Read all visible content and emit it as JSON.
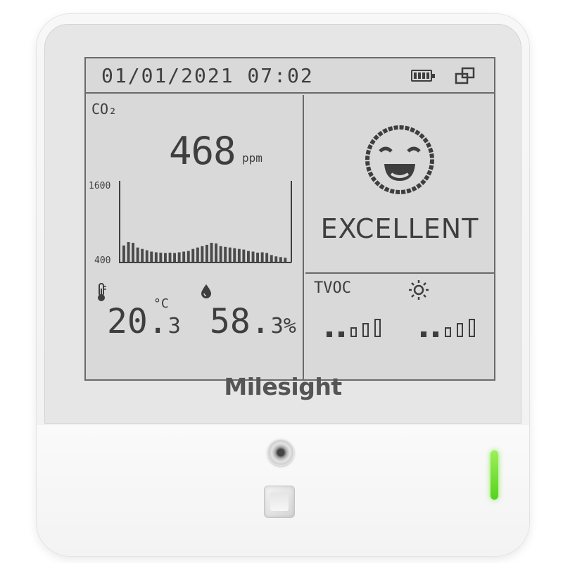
{
  "header": {
    "datetime": "01/01/2021  07:02",
    "battery_icon": "battery-icon",
    "network_icon": "network-icon"
  },
  "co2": {
    "label": "CO₂",
    "value": "468",
    "unit": "ppm"
  },
  "chart_data": {
    "type": "bar",
    "y_tick_labels": [
      "1600",
      "400"
    ],
    "ylim": [
      400,
      1600
    ],
    "values": [
      650,
      700,
      690,
      620,
      600,
      580,
      560,
      550,
      545,
      540,
      545,
      540,
      550,
      560,
      570,
      600,
      620,
      640,
      660,
      690,
      680,
      640,
      630,
      620,
      610,
      600,
      590,
      570,
      560,
      545,
      550,
      540,
      510,
      490,
      480,
      470
    ],
    "grid": false
  },
  "temperature": {
    "value_int": "20.",
    "value_dec": "3",
    "unit": "°C",
    "icon": "thermometer-icon"
  },
  "humidity": {
    "value_int": "58.",
    "value_dec": "3%",
    "icon": "water-drop-icon"
  },
  "status": {
    "icon": "smiley-face-icon",
    "text": "EXCELLENT"
  },
  "tvoc": {
    "label": "TVOC",
    "level": 2,
    "max": 5
  },
  "light": {
    "icon": "sun-icon",
    "level": 2,
    "max": 5
  },
  "brand": {
    "name": "Milesight"
  },
  "colors": {
    "screen": "#d9d9d9",
    "segment": "#3e3e3e",
    "led": "#6ee032"
  }
}
